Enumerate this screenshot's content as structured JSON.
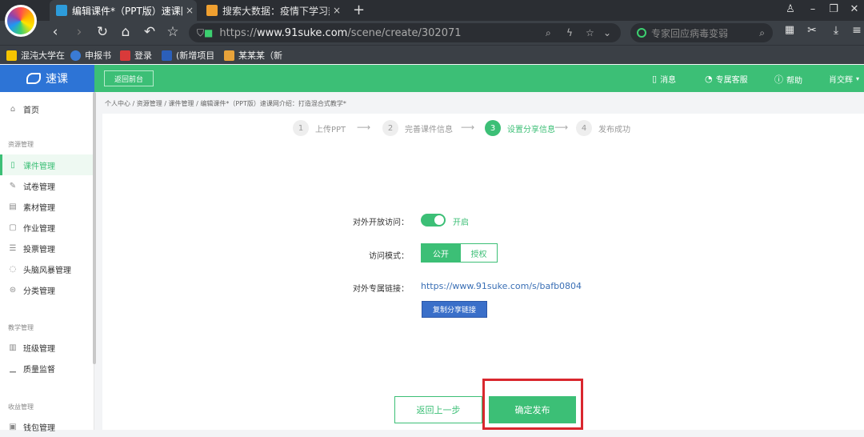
{
  "browser": {
    "tabs": [
      {
        "title": "编辑课件*（PPT版）速课网介",
        "close": "×"
      },
      {
        "title": "搜索大数据：疫情下学习热度",
        "close": "×"
      }
    ],
    "new_tab": "+",
    "url": {
      "scheme": "https://",
      "host": "www.91suke.com",
      "path": "/scene/create/302071"
    },
    "search_placeholder": "专家回应病毒变弱",
    "bookmarks": [
      "混沌大学在",
      "申报书",
      "登录",
      "(新增项目",
      "某某某（新"
    ]
  },
  "app": {
    "logo_text": "速课",
    "back_console": "返回前台",
    "header_items": [
      {
        "icon": "bell-icon",
        "label": "消息"
      },
      {
        "icon": "headset-icon",
        "label": "专属客服"
      },
      {
        "icon": "help-icon",
        "label": "帮助"
      },
      {
        "icon": "user-icon",
        "label": "肖交辉"
      }
    ]
  },
  "sidebar": {
    "home": "首页",
    "groups": [
      {
        "title": "资源管理",
        "items": [
          "课件管理",
          "试卷管理",
          "素材管理",
          "作业管理",
          "投票管理",
          "头脑风暴管理",
          "分类管理"
        ]
      },
      {
        "title": "教学管理",
        "items": [
          "班级管理",
          "质量监督"
        ]
      },
      {
        "title": "收益管理",
        "items": [
          "钱包管理"
        ]
      }
    ],
    "active": "课件管理"
  },
  "breadcrumb": "个人中心 / 资源管理 / 课件管理 / 编辑课件*（PPT版）速课网介绍：打造混合式教学*",
  "steps": [
    {
      "num": "1",
      "label": "上传PPT"
    },
    {
      "num": "2",
      "label": "完善课件信息"
    },
    {
      "num": "3",
      "label": "设置分享信息"
    },
    {
      "num": "4",
      "label": "发布成功"
    }
  ],
  "active_step": 3,
  "form": {
    "open_access_label": "对外开放访问：",
    "open_access_state": "开启",
    "open_access_on": true,
    "mode_label": "访问模式：",
    "mode_options": [
      "公开",
      "授权"
    ],
    "mode_selected": "公开",
    "link_label": "对外专属链接：",
    "link_value": "https://www.91suke.com/s/bafb0804",
    "copy_button": "复制分享链接"
  },
  "actions": {
    "prev": "返回上一步",
    "publish": "确定发布"
  },
  "colors": {
    "brand": "#3cbf76",
    "logo_bg": "#2d74d6",
    "highlight": "#d9272e",
    "link": "#3a6fb5"
  }
}
